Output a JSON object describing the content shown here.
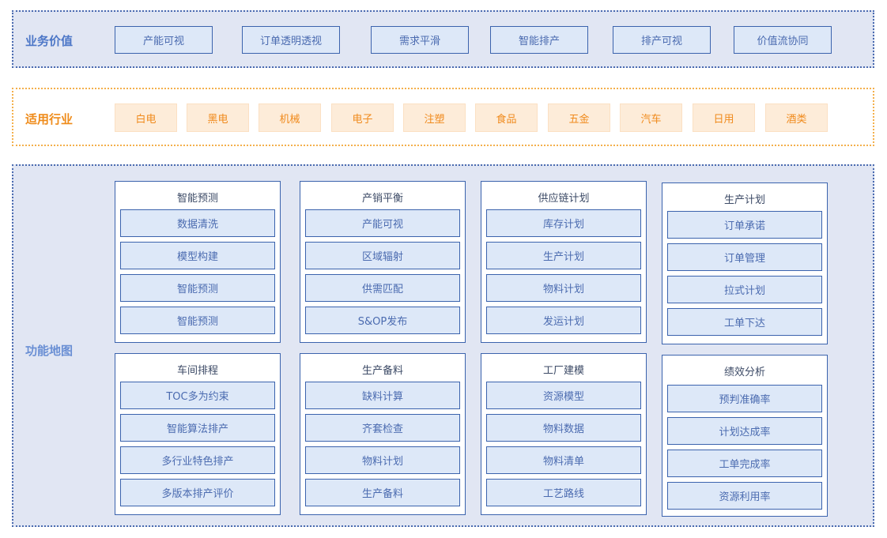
{
  "business_value": {
    "label": "业务价值",
    "items": [
      "产能可视",
      "订单透明透视",
      "需求平滑",
      "智能排产",
      "排产可视",
      "价值流协同"
    ]
  },
  "industries": {
    "label": "适用行业",
    "items": [
      "白电",
      "黑电",
      "机械",
      "电子",
      "注塑",
      "食品",
      "五金",
      "汽车",
      "日用",
      "酒类"
    ]
  },
  "function_map": {
    "label": "功能地图",
    "modules": [
      {
        "title": "智能预测",
        "items": [
          "数据清洗",
          "模型构建",
          "智能预测",
          "智能预测"
        ]
      },
      {
        "title": "产销平衡",
        "items": [
          "产能可视",
          "区域辐射",
          "供需匹配",
          "S&OP发布"
        ]
      },
      {
        "title": "供应链计划",
        "items": [
          "库存计划",
          "生产计划",
          "物料计划",
          "发运计划"
        ]
      },
      {
        "title": "生产计划",
        "items": [
          "订单承诺",
          "订单管理",
          "拉式计划",
          "工单下达"
        ]
      },
      {
        "title": "车间排程",
        "items": [
          "TOC多为约束",
          "智能算法排产",
          "多行业特色排产",
          "多版本排产评价"
        ]
      },
      {
        "title": "生产备料",
        "items": [
          "缺料计算",
          "齐套检查",
          "物料计划",
          "生产备料"
        ]
      },
      {
        "title": "工厂建模",
        "items": [
          "资源模型",
          "物料数据",
          "物料清单",
          "工艺路线"
        ]
      },
      {
        "title": "绩效分析",
        "items": [
          "预判准确率",
          "计划达成率",
          "工单完成率",
          "资源利用率"
        ]
      }
    ]
  },
  "colors": {
    "blue_border": "#3b63ad",
    "blue_fill": "#dde8f8",
    "band_fill": "#e1e6f3",
    "orange_border": "#f4b04c",
    "orange_fill": "#fdecd9",
    "orange_text": "#f08a1c"
  }
}
